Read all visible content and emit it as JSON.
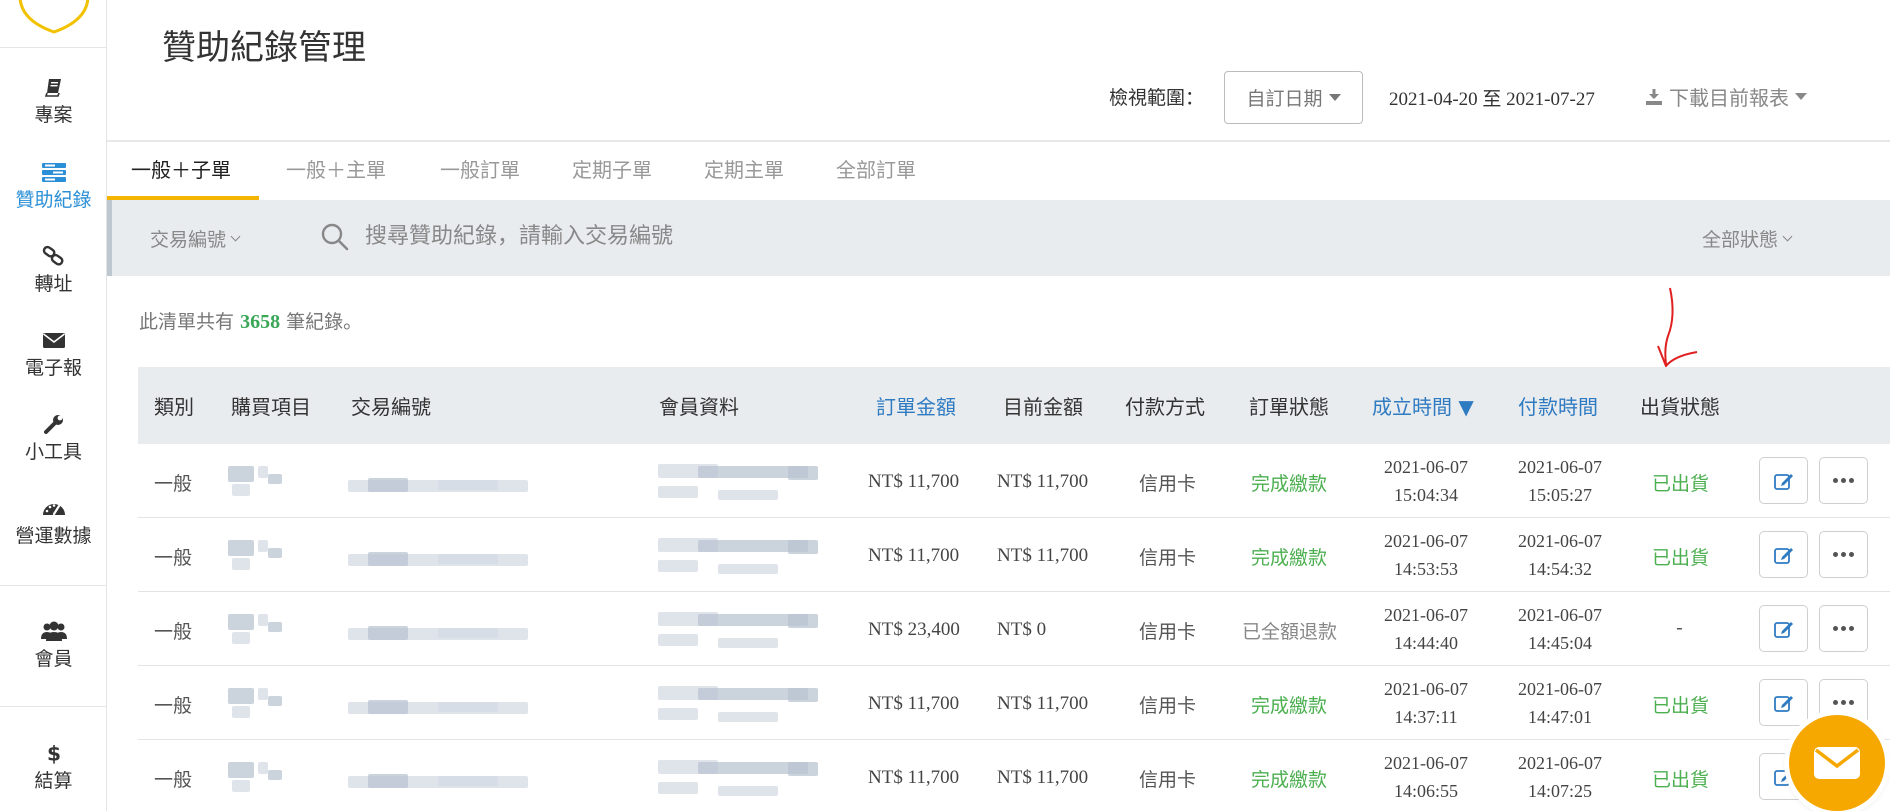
{
  "app": {
    "page_title": "贊助紀錄管理"
  },
  "sidebar": {
    "items": [
      {
        "label": "專案",
        "icon": "book-icon"
      },
      {
        "label": "贊助紀錄",
        "icon": "list-icon",
        "active": true
      },
      {
        "label": "轉址",
        "icon": "link-icon"
      },
      {
        "label": "電子報",
        "icon": "envelope-icon"
      },
      {
        "label": "小工具",
        "icon": "wrench-icon"
      },
      {
        "label": "營運數據",
        "icon": "dashboard-icon"
      },
      {
        "label": "會員",
        "icon": "users-icon"
      },
      {
        "label": "結算",
        "icon": "dollar-icon"
      }
    ]
  },
  "header": {
    "range_label": "檢視範圍：",
    "range_select": "自訂日期",
    "date_from": "2021-04-20",
    "date_sep": "至",
    "date_to": "2021-07-27",
    "download_label": "下載目前報表"
  },
  "tabs": [
    {
      "label": "一般＋子單",
      "active": true
    },
    {
      "label": "一般＋主單"
    },
    {
      "label": "一般訂單"
    },
    {
      "label": "定期子單"
    },
    {
      "label": "定期主單"
    },
    {
      "label": "全部訂單"
    }
  ],
  "search": {
    "filter_label": "交易編號",
    "placeholder": "搜尋贊助紀錄，請輸入交易編號",
    "status_label": "全部狀態"
  },
  "summary": {
    "prefix": "此清單共有",
    "count": "3658",
    "suffix": "筆紀錄。"
  },
  "table": {
    "columns": [
      "類別",
      "購買項目",
      "交易編號",
      "會員資料",
      "訂單金額",
      "目前金額",
      "付款方式",
      "訂單狀態",
      "成立時間 ▼",
      "付款時間",
      "出貨狀態"
    ],
    "rows": [
      {
        "type": "一般",
        "order_amount": "NT$ 11,700",
        "current_amount": "NT$ 11,700",
        "payment": "信用卡",
        "status": "完成繳款",
        "status_kind": "ok",
        "created_date": "2021-06-07",
        "created_time": "15:04:34",
        "paid_date": "2021-06-07",
        "paid_time": "15:05:27",
        "ship": "已出貨"
      },
      {
        "type": "一般",
        "order_amount": "NT$ 11,700",
        "current_amount": "NT$ 11,700",
        "payment": "信用卡",
        "status": "完成繳款",
        "status_kind": "ok",
        "created_date": "2021-06-07",
        "created_time": "14:53:53",
        "paid_date": "2021-06-07",
        "paid_time": "14:54:32",
        "ship": "已出貨"
      },
      {
        "type": "一般",
        "order_amount": "NT$ 23,400",
        "current_amount": "NT$ 0",
        "payment": "信用卡",
        "status": "已全額退款",
        "status_kind": "refund",
        "created_date": "2021-06-07",
        "created_time": "14:44:40",
        "paid_date": "2021-06-07",
        "paid_time": "14:45:04",
        "ship": "-"
      },
      {
        "type": "一般",
        "order_amount": "NT$ 11,700",
        "current_amount": "NT$ 11,700",
        "payment": "信用卡",
        "status": "完成繳款",
        "status_kind": "ok",
        "created_date": "2021-06-07",
        "created_time": "14:37:11",
        "paid_date": "2021-06-07",
        "paid_time": "14:47:01",
        "ship": "已出貨"
      },
      {
        "type": "一般",
        "order_amount": "NT$ 11,700",
        "current_amount": "NT$ 11,700",
        "payment": "信用卡",
        "status": "完成繳款",
        "status_kind": "ok",
        "created_date": "2021-06-07",
        "created_time": "14:06:55",
        "paid_date": "2021-06-07",
        "paid_time": "14:07:25",
        "ship": "已出貨"
      }
    ]
  },
  "colors": {
    "accent": "#2a8fd6",
    "tab_underline": "#f4b400",
    "success": "#4caf50",
    "chat": "#f6a800",
    "annotation": "#e02020"
  }
}
